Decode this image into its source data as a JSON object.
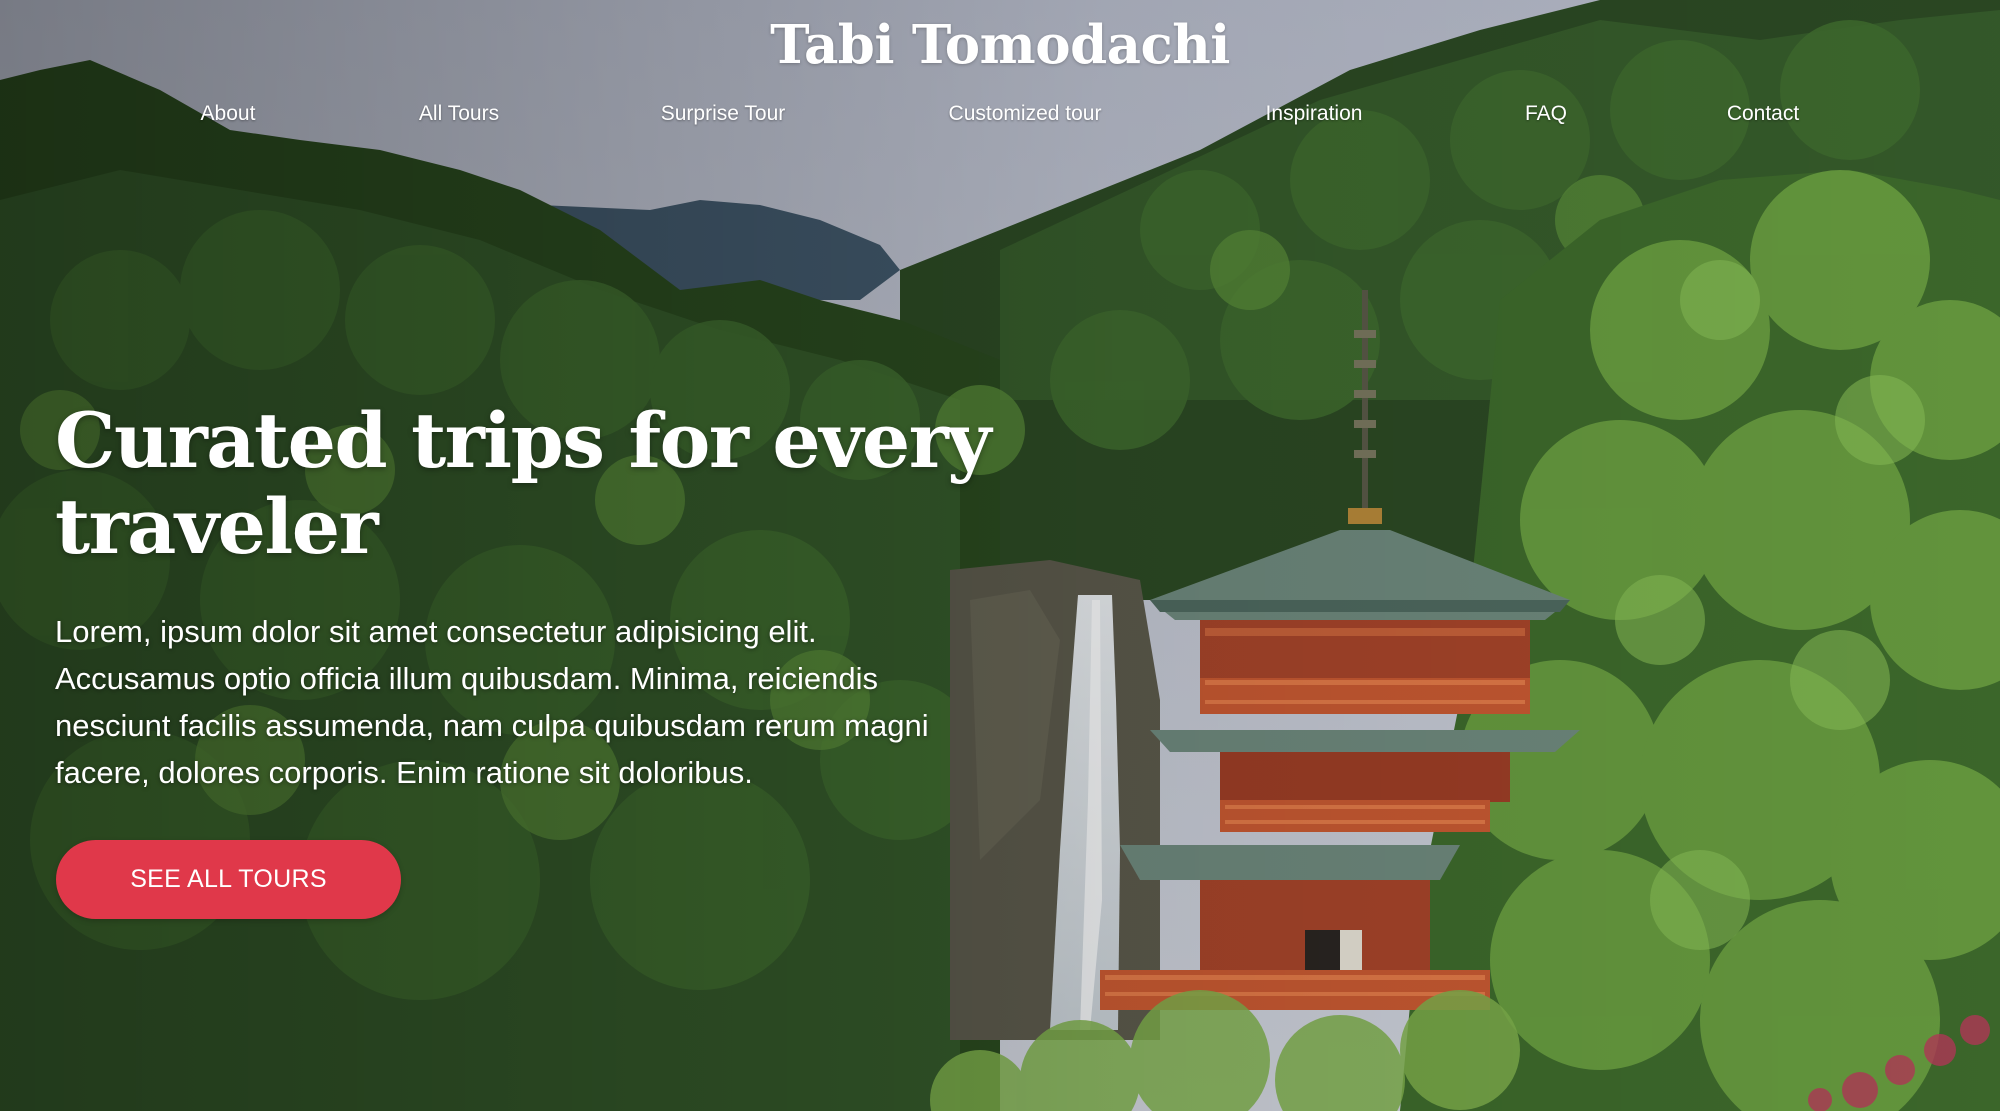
{
  "site": {
    "brand": "Tabi Tomodachi"
  },
  "nav": {
    "items": [
      {
        "label": "About"
      },
      {
        "label": "All Tours"
      },
      {
        "label": "Surprise Tour"
      },
      {
        "label": "Customized tour"
      },
      {
        "label": "Inspiration"
      },
      {
        "label": "FAQ"
      },
      {
        "label": "Contact"
      }
    ]
  },
  "hero": {
    "headline": "Curated trips for every traveler",
    "body": "Lorem, ipsum dolor sit amet consectetur adipisicing elit. Accusamus optio officia illum quibusdam. Minima, reiciendis nesciunt facilis assumenda, nam culpa quibusdam rerum magni facere, dolores corporis. Enim ratione sit doloribus.",
    "cta_label": "SEE ALL TOURS",
    "background": "photo of forested mountain valley with waterfall and red pagoda"
  },
  "colors": {
    "cta": "#e0384a",
    "text": "#ffffff"
  }
}
